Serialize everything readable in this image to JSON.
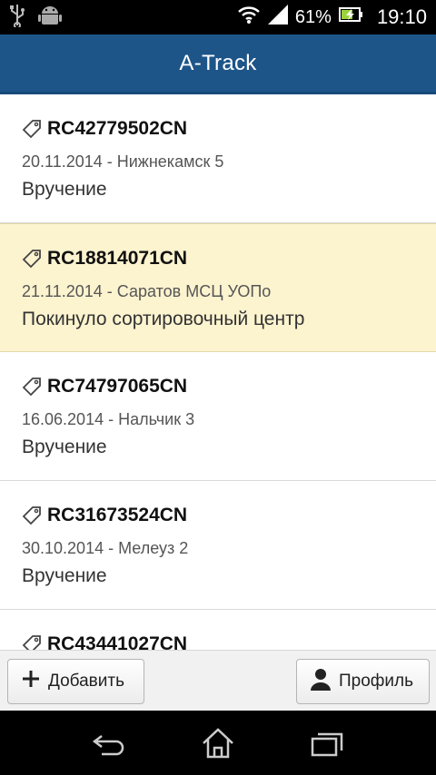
{
  "status_bar": {
    "battery": "61%",
    "time": "19:10"
  },
  "app_bar": {
    "title": "A-Track"
  },
  "list": {
    "items": [
      {
        "track": "RC42779502CN",
        "meta": "20.11.2014 - Нижнекамск 5",
        "status": "Вручение",
        "highlighted": false
      },
      {
        "track": "RC18814071CN",
        "meta": "21.11.2014 - Саратов МСЦ УОПо",
        "status": "Покинуло сортировочный центр",
        "highlighted": true
      },
      {
        "track": "RC74797065CN",
        "meta": "16.06.2014 - Нальчик 3",
        "status": "Вручение",
        "highlighted": false
      },
      {
        "track": "RC31673524CN",
        "meta": "30.10.2014 - Мелеуз 2",
        "status": "Вручение",
        "highlighted": false
      },
      {
        "track": "RC43441027CN",
        "meta": "",
        "status": "",
        "highlighted": false
      }
    ]
  },
  "toolbar": {
    "add_label": "Добавить",
    "profile_label": "Профиль"
  },
  "icons": {
    "usb": "usb-icon",
    "android": "android-icon",
    "wifi": "wifi-icon",
    "signal": "signal-icon",
    "battery": "battery-charging-icon",
    "tag": "tag-icon",
    "plus": "plus-icon",
    "user": "user-icon",
    "back": "back-icon",
    "home": "home-icon",
    "recent": "recent-apps-icon"
  },
  "colors": {
    "app_bar": "#1d5589",
    "highlight": "#fcf3cf"
  }
}
